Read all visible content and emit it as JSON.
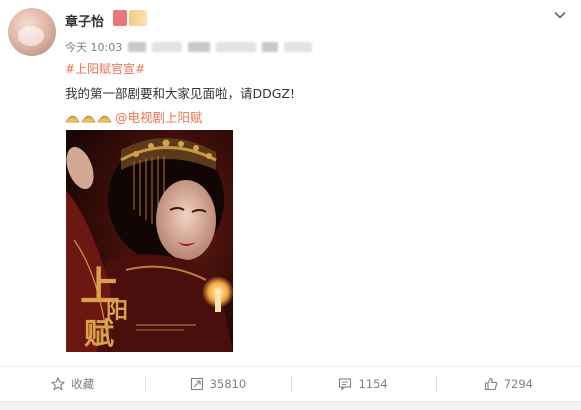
{
  "post": {
    "username": "章子怡",
    "timestamp": "今天 10:03",
    "topic": "#上阳赋官宣#",
    "text": "我的第一部剧要和大家见面啦，请DDGZ!",
    "mention": "@电视剧上阳赋"
  },
  "poster": {
    "title_glyphs": [
      "上",
      "阳",
      "赋"
    ],
    "icon": "drama-poster-image"
  },
  "actions": {
    "favorite_label": "收藏",
    "repost_count": "35810",
    "comment_count": "1154",
    "like_count": "7294"
  },
  "colors": {
    "accent": "#eb7350",
    "text": "#333333",
    "muted": "#808080",
    "gold": "#d9a24a"
  },
  "icons": [
    "avatar",
    "chevron-down-icon",
    "emoji-icon",
    "star-icon",
    "repost-icon",
    "comment-icon",
    "like-icon"
  ]
}
